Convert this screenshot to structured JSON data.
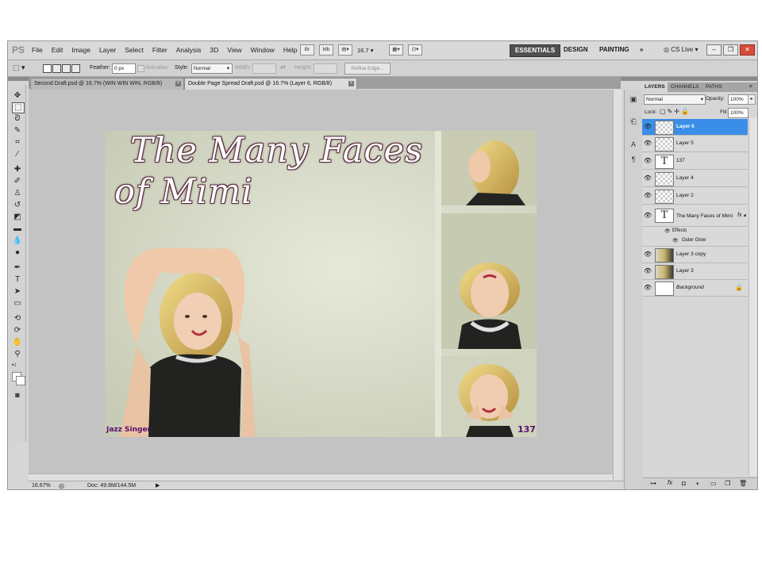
{
  "menu": {
    "logo": "PS",
    "items": [
      "File",
      "Edit",
      "Image",
      "Layer",
      "Select",
      "Filter",
      "Analysis",
      "3D",
      "View",
      "Window",
      "Help"
    ],
    "bridge": "Br",
    "minibridge": "Mb",
    "zoom": "16.7",
    "workspaces": [
      "ESSENTIALS",
      "DESIGN",
      "PAINTING"
    ],
    "more": "»",
    "cslive": "CS Live"
  },
  "options": {
    "feather_label": "Feather:",
    "feather_value": "0 px",
    "antialias_label": "Anti-alias",
    "style_label": "Style:",
    "style_value": "Normal",
    "width_label": "Width:",
    "height_label": "Height:",
    "refine_label": "Refine Edge..."
  },
  "tabs": [
    {
      "label": "Second Draft.psd @ 16.7% (WIN WIN WIN, RGB/8)"
    },
    {
      "label": "Double Page Spread Draft.psd @ 16.7% (Layer 6, RGB/8)"
    }
  ],
  "document": {
    "title_line1": "The Many Faces",
    "title_line2": "of Mimi",
    "caption_left": "Jazz Singer",
    "page_number": "137"
  },
  "status": {
    "zoom": "16.67%",
    "doc": "Doc: 49.8M/144.5M"
  },
  "layers_panel": {
    "tabs": [
      "LAYERS",
      "CHANNELS",
      "PATHS"
    ],
    "blend_mode": "Normal",
    "opacity_label": "Opacity:",
    "opacity_value": "100%",
    "lock_label": "Lock:",
    "fill_label": "Fill:",
    "fill_value": "100%",
    "layers": [
      {
        "name": "Layer 6"
      },
      {
        "name": "Layer 5"
      },
      {
        "name": "137"
      },
      {
        "name": "Layer 4"
      },
      {
        "name": "Layer 2"
      },
      {
        "name": "The Many Faces of Mimi"
      },
      {
        "name": "Effects"
      },
      {
        "name": "Outer Glow"
      },
      {
        "name": "Layer 3 copy"
      },
      {
        "name": "Layer 3"
      },
      {
        "name": "Background"
      }
    ]
  },
  "colors": {
    "selection_blue": "#3a8ee8",
    "canvas_gray": "#c3c3c3",
    "caption_purple": "#5a0f6e"
  }
}
